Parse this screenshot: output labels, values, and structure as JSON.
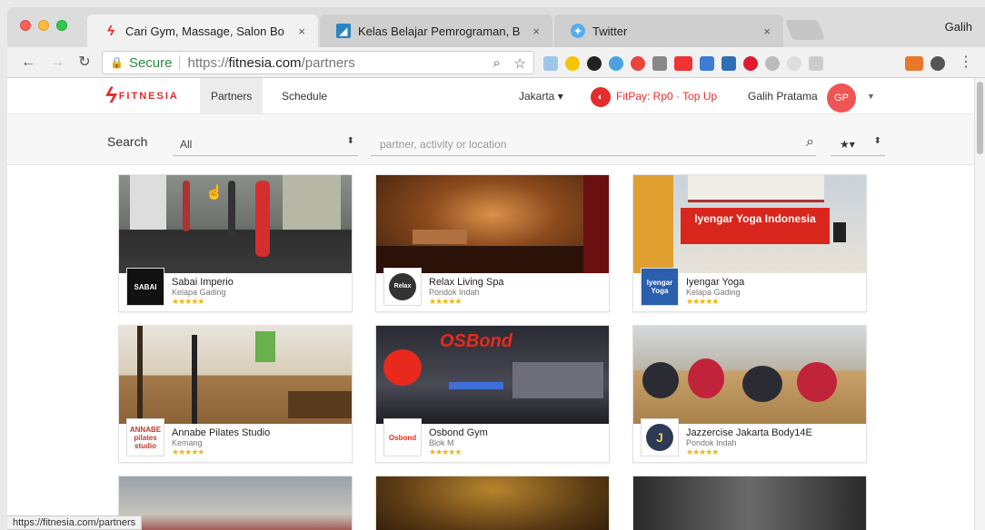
{
  "browser": {
    "profile_name": "Galih",
    "tabs": [
      {
        "title": "Cari Gym, Massage, Salon Bo",
        "active": true,
        "icon": "fitnesia-favicon"
      },
      {
        "title": "Kelas Belajar Pemrograman, B",
        "active": false,
        "icon": "dicoding-favicon"
      },
      {
        "title": "Twitter",
        "active": false,
        "icon": "twitter-favicon"
      }
    ],
    "close_glyph": "×",
    "omnibox": {
      "secure_label": "Secure",
      "url_scheme": "https://",
      "url_host": "fitnesia.com",
      "url_path": "/partners"
    },
    "status_url": "https://fitnesia.com/partners"
  },
  "site": {
    "logo_text": "FITNESIA",
    "nav": [
      {
        "label": "Partners",
        "active": true
      },
      {
        "label": "Schedule",
        "active": false
      }
    ],
    "city": "Jakarta",
    "fitpay": "FitPay: Rp0 · Top Up",
    "user_name": "Galih Pratama",
    "avatar_initials": "GP"
  },
  "search": {
    "label": "Search",
    "category_value": "All",
    "query_placeholder": "partner, activity or location",
    "sort_value": "★▾"
  },
  "partners": [
    {
      "name": "Sabai Imperio",
      "location": "Kelapa Gading",
      "rating": 5,
      "logo_text": "SABAI"
    },
    {
      "name": "Relax Living Spa",
      "location": "Pondok Indah",
      "rating": 5,
      "logo_text": "Relax"
    },
    {
      "name": "Iyengar Yoga",
      "location": "Kelapa Gading",
      "rating": 5,
      "logo_text": "Iyengar Yoga"
    },
    {
      "name": "Annabe Pilates Studio",
      "location": "Kemang",
      "rating": 5,
      "logo_text": "ANNABE pilates studio"
    },
    {
      "name": "Osbond Gym",
      "location": "Blok M",
      "rating": 5,
      "logo_text": "Osbond"
    },
    {
      "name": "Jazzercise Jakarta Body14E",
      "location": "Pondok Indah",
      "rating": 5,
      "logo_text": "J"
    }
  ],
  "photo_signs": {
    "iyengar": "Iyengar Yoga Indonesia",
    "osbond": "OSBond"
  },
  "colors": {
    "brand_red": "#e52b2b",
    "star_gold": "#f2b705"
  }
}
